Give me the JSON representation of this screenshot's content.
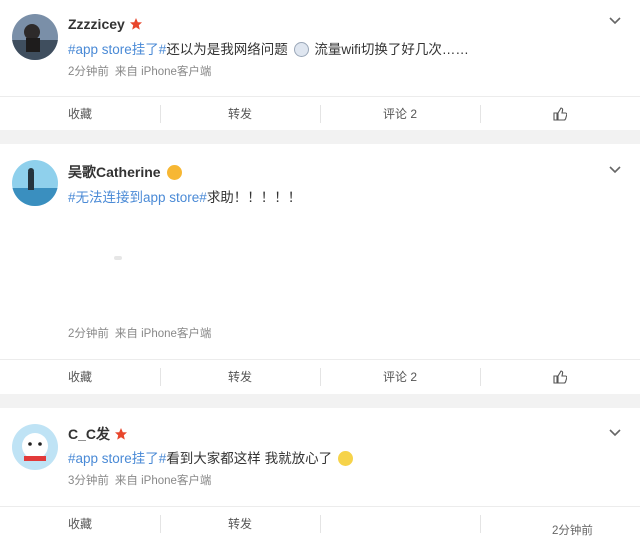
{
  "posts": [
    {
      "username": "Zzzzicey",
      "content": {
        "topic": "#app store挂了#",
        "text_before_emoji": "还以为是我网络问题",
        "text_after_emoji": "流量wifi切换了好几次……"
      },
      "meta": {
        "time": "2分钟前",
        "source": "来自 iPhone客户端"
      },
      "actions": {
        "favorite": "收藏",
        "repost": "转发",
        "comment": "评论 2"
      }
    },
    {
      "username": "吴歌Catherine",
      "content": {
        "topic": "#无法连接到app store#",
        "text": "求助！！！！！"
      },
      "meta": {
        "time": "2分钟前",
        "source": "来自 iPhone客户端"
      },
      "actions": {
        "favorite": "收藏",
        "repost": "转发",
        "comment": "评论 2"
      }
    },
    {
      "username": "C_C发",
      "content": {
        "topic": "#app store挂了#",
        "text": "看到大家都这样 我就放心了"
      },
      "meta": {
        "time": "3分钟前",
        "source": "来自 iPhone客户端"
      },
      "actions": {
        "favorite": "收藏",
        "repost": "转发"
      }
    }
  ],
  "overlay_time": "2分钟前",
  "colors": {
    "topic": "#4a8ad6",
    "vip_star": "#e8462c",
    "background": "#f2f2f2"
  },
  "icons": [
    "chevron-down-icon",
    "thumbs-up-icon",
    "vip-star-icon",
    "emoji-icon"
  ]
}
